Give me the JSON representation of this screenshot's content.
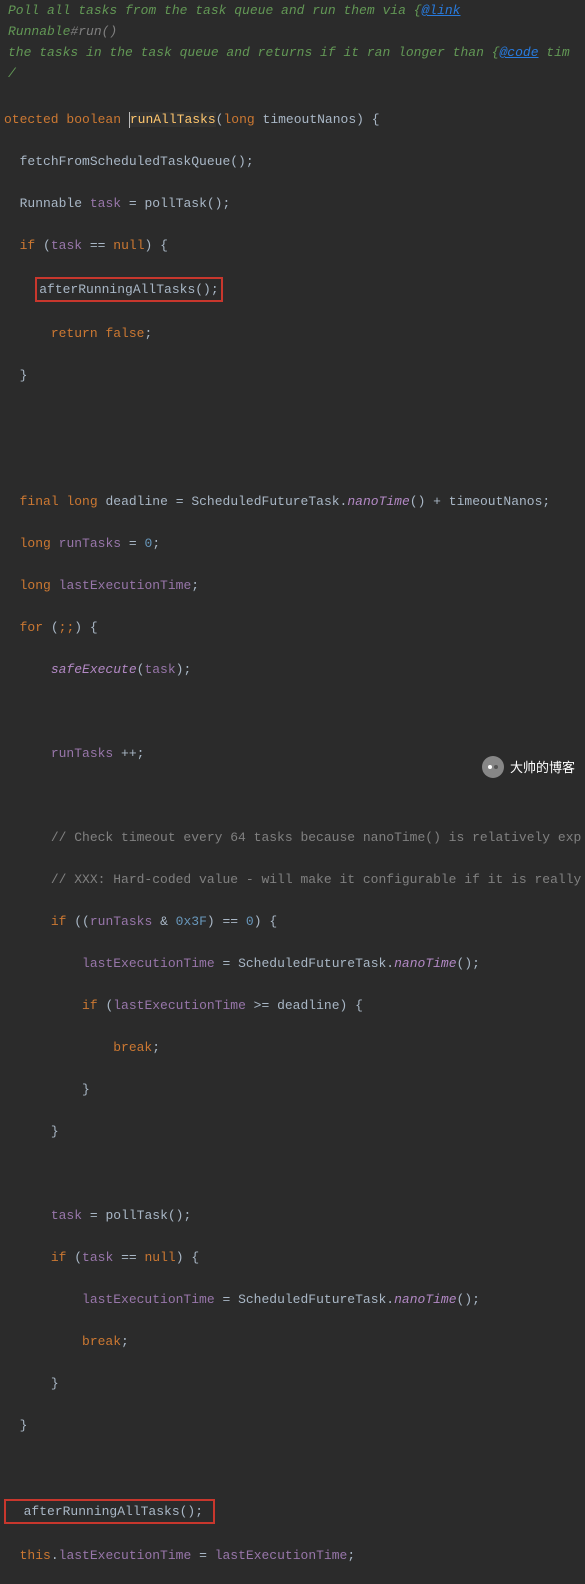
{
  "doc": {
    "l1_a": "Poll all tasks from the task queue and run them via {",
    "l1_link": "@link",
    "l1_b": " Runnable",
    "l1_c": "#run()",
    "l2_a": "the tasks in the task queue and returns if it ran longer than {",
    "l2_link": "@code",
    "l2_b": " tim"
  },
  "code": {
    "mod_prot": "otected",
    "bool": "boolean",
    "fn": "runAllTasks",
    "long": "long",
    "p_timeout": "timeoutNanos",
    "brace_o": ") {",
    "fetch": "fetchFromScheduledTaskQueue();",
    "Runnable": "Runnable",
    "task": "task",
    "eq": " = ",
    "pollTask": "pollTask();",
    "if": "if",
    "null": "null",
    "afterRun": "afterRunningAllTasks();",
    "return": "return",
    "false": "false",
    "final": "final",
    "deadline": "deadline",
    "SFT": "ScheduledFutureTask.",
    "nanoTime": "nanoTime",
    "plusTimeout": "() + timeoutNanos;",
    "runTasks": "runTasks",
    "zero": "0",
    "lastExec": "lastExecutionTime",
    "for": "for",
    "safeExec": "safeExecute",
    "pp": " ++;",
    "c1": "// Check timeout every 64 tasks because nanoTime() is relatively exp",
    "c2": "// XXX: Hard-coded value - will make it configurable if it is really",
    "amp": " & ",
    "hex3f": "0x3F",
    "eqeq": ") == ",
    "geq_deadline": " >= deadline) {",
    "break": "break",
    "this": "this",
    "dot": "."
  },
  "watermark": "大帅的博客"
}
